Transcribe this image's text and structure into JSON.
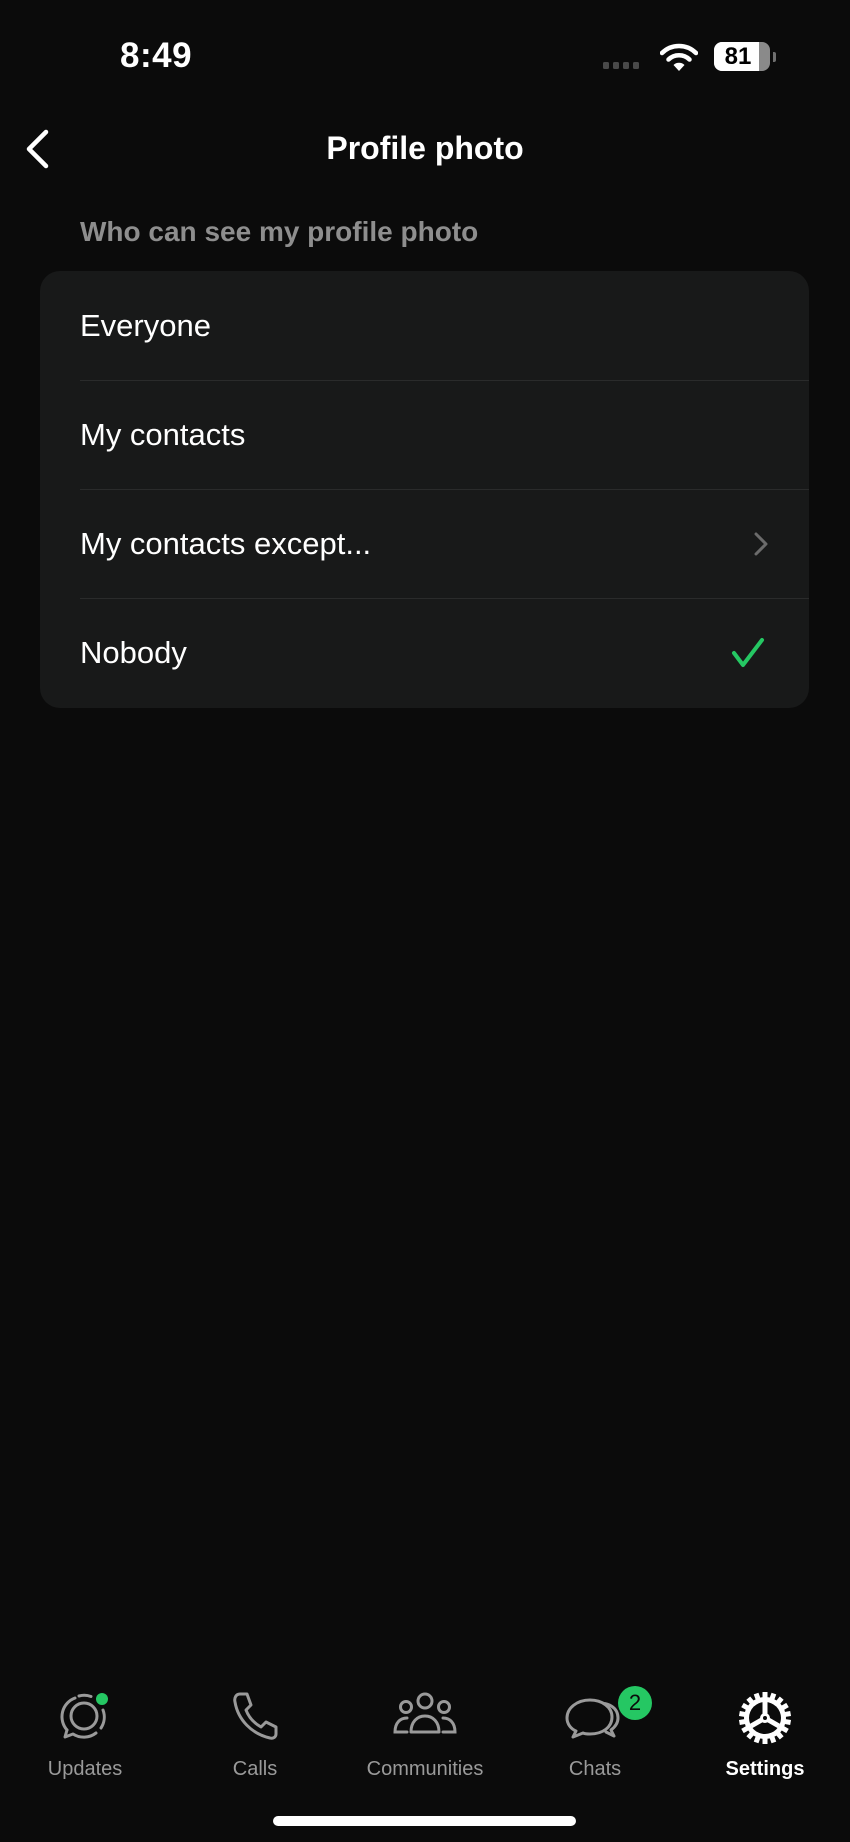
{
  "status_bar": {
    "time": "8:49",
    "battery_percent": "81",
    "battery_level": 0.81,
    "icons": [
      "signal-dots-icon",
      "wifi-icon",
      "battery-icon"
    ]
  },
  "nav": {
    "back_icon": "chevron-left-icon",
    "title": "Profile photo"
  },
  "section": {
    "label": "Who can see my profile photo"
  },
  "options": [
    {
      "label": "Everyone",
      "selected": false,
      "trailing": ""
    },
    {
      "label": "My contacts",
      "selected": false,
      "trailing": ""
    },
    {
      "label": "My contacts except...",
      "selected": false,
      "trailing": "chevron-right-icon"
    },
    {
      "label": "Nobody",
      "selected": true,
      "trailing": "checkmark-icon"
    }
  ],
  "tabbar": {
    "tabs": [
      {
        "label": "Updates",
        "icon": "updates-icon",
        "active": false,
        "dot": true
      },
      {
        "label": "Calls",
        "icon": "phone-icon",
        "active": false
      },
      {
        "label": "Communities",
        "icon": "communities-icon",
        "active": false
      },
      {
        "label": "Chats",
        "icon": "chats-icon",
        "active": false,
        "badge": "2"
      },
      {
        "label": "Settings",
        "icon": "gear-icon",
        "active": true
      }
    ]
  },
  "colors": {
    "accent": "#25c763",
    "background": "#0b0b0b",
    "card": "#181919",
    "secondary_text": "#8e8e8e"
  }
}
